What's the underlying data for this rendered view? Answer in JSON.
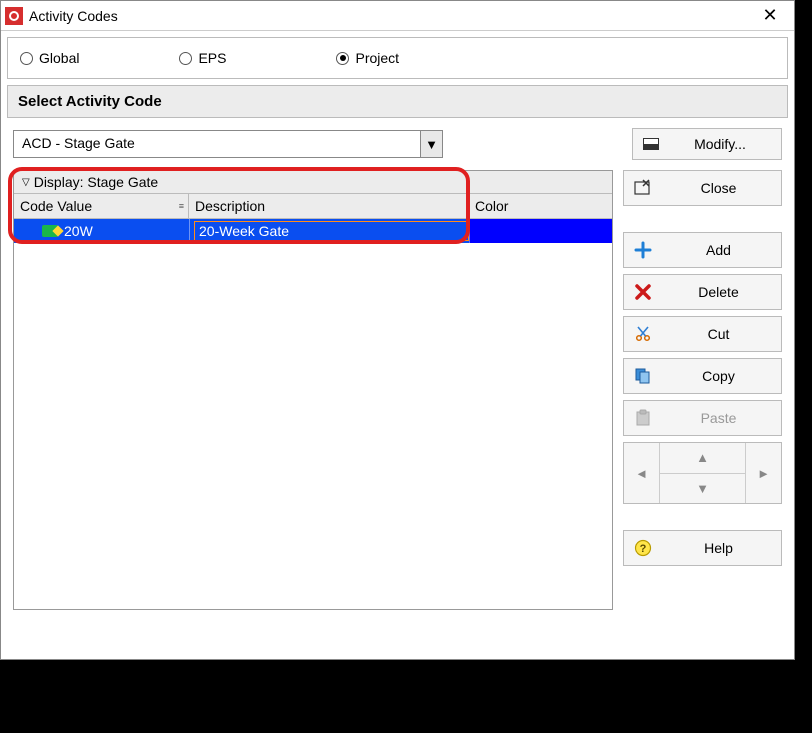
{
  "window": {
    "title": "Activity Codes"
  },
  "radios": {
    "global": "Global",
    "eps": "EPS",
    "project": "Project",
    "selected": "project"
  },
  "section": {
    "header": "Select Activity Code"
  },
  "dropdown": {
    "value": "ACD - Stage Gate"
  },
  "buttons": {
    "modify": "Modify...",
    "close": "Close",
    "add": "Add",
    "delete": "Delete",
    "cut": "Cut",
    "copy": "Copy",
    "paste": "Paste",
    "help": "Help"
  },
  "table": {
    "display_label": "Display: Stage Gate",
    "headers": {
      "code": "Code Value",
      "desc": "Description",
      "color": "Color"
    },
    "rows": [
      {
        "code": "20W",
        "desc": "20-Week Gate",
        "color": "#0000ff"
      }
    ]
  }
}
